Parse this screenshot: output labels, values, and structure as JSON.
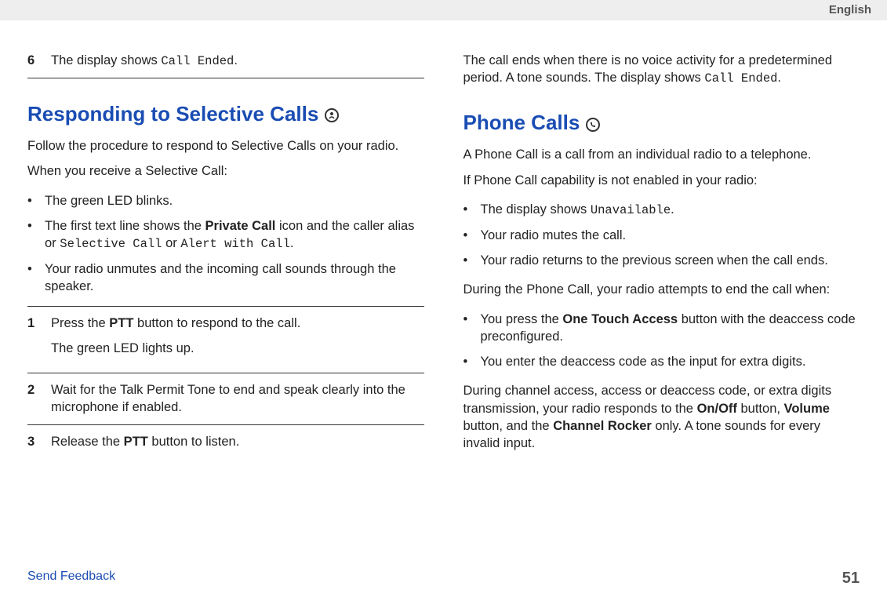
{
  "header": {
    "language": "English"
  },
  "left": {
    "step6_num": "6",
    "step6_prefix": "The display shows ",
    "step6_mono": "Call Ended",
    "step6_suffix": ".",
    "heading1": "Responding to Selective Calls",
    "intro1": "Follow the procedure to respond to Selective Calls on your radio.",
    "when_receive": "When you receive a Selective Call:",
    "bullets": {
      "b1": "The green LED blinks.",
      "b2_prefix": "The first text line shows the ",
      "b2_bold": "Private Call",
      "b2_mid": " icon and the caller alias or ",
      "b2_mono1": "Selective Call",
      "b2_or": " or ",
      "b2_mono2": "Alert with Call",
      "b2_suffix": ".",
      "b3": "Your radio unmutes and the incoming call sounds through the speaker."
    },
    "steps": {
      "s1_num": "1",
      "s1_a_prefix": "Press the ",
      "s1_a_bold": "PTT",
      "s1_a_suffix": " button to respond to the call.",
      "s1_b": "The green LED lights up.",
      "s2_num": "2",
      "s2": "Wait for the Talk Permit Tone to end and speak clearly into the microphone if enabled.",
      "s3_num": "3",
      "s3_prefix": "Release the ",
      "s3_bold": "PTT",
      "s3_suffix": " button to listen."
    }
  },
  "right": {
    "para1_prefix": "The call ends when there is no voice activity for a predetermined period. A tone sounds. The display shows ",
    "para1_mono": "Call Ended",
    "para1_suffix": ".",
    "heading2": "Phone Calls",
    "intro2": "A Phone Call is a call from an individual radio to a telephone.",
    "if_not": "If Phone Call capability is not enabled in your radio:",
    "bulletsA": {
      "a1_prefix": "The display shows ",
      "a1_mono": "Unavailable",
      "a1_suffix": ".",
      "a2": "Your radio mutes the call.",
      "a3": "Your radio returns to the previous screen when the call ends."
    },
    "during": "During the Phone Call, your radio attempts to end the call when:",
    "bulletsB": {
      "b1_prefix": "You press the ",
      "b1_bold": "One Touch Access",
      "b1_suffix": " button with the deaccess code preconfigured.",
      "b2": "You enter the deaccess code as the input for extra digits."
    },
    "para2_a": "During channel access, access or deaccess code, or extra digits transmission, your radio responds to the ",
    "para2_bold1": "On/Off",
    "para2_b": " button, ",
    "para2_bold2": "Volume",
    "para2_c": " button, and the ",
    "para2_bold3": "Channel Rocker",
    "para2_d": " only. A tone sounds for every invalid input."
  },
  "footer": {
    "send_feedback": "Send Feedback",
    "page_num": "51"
  }
}
